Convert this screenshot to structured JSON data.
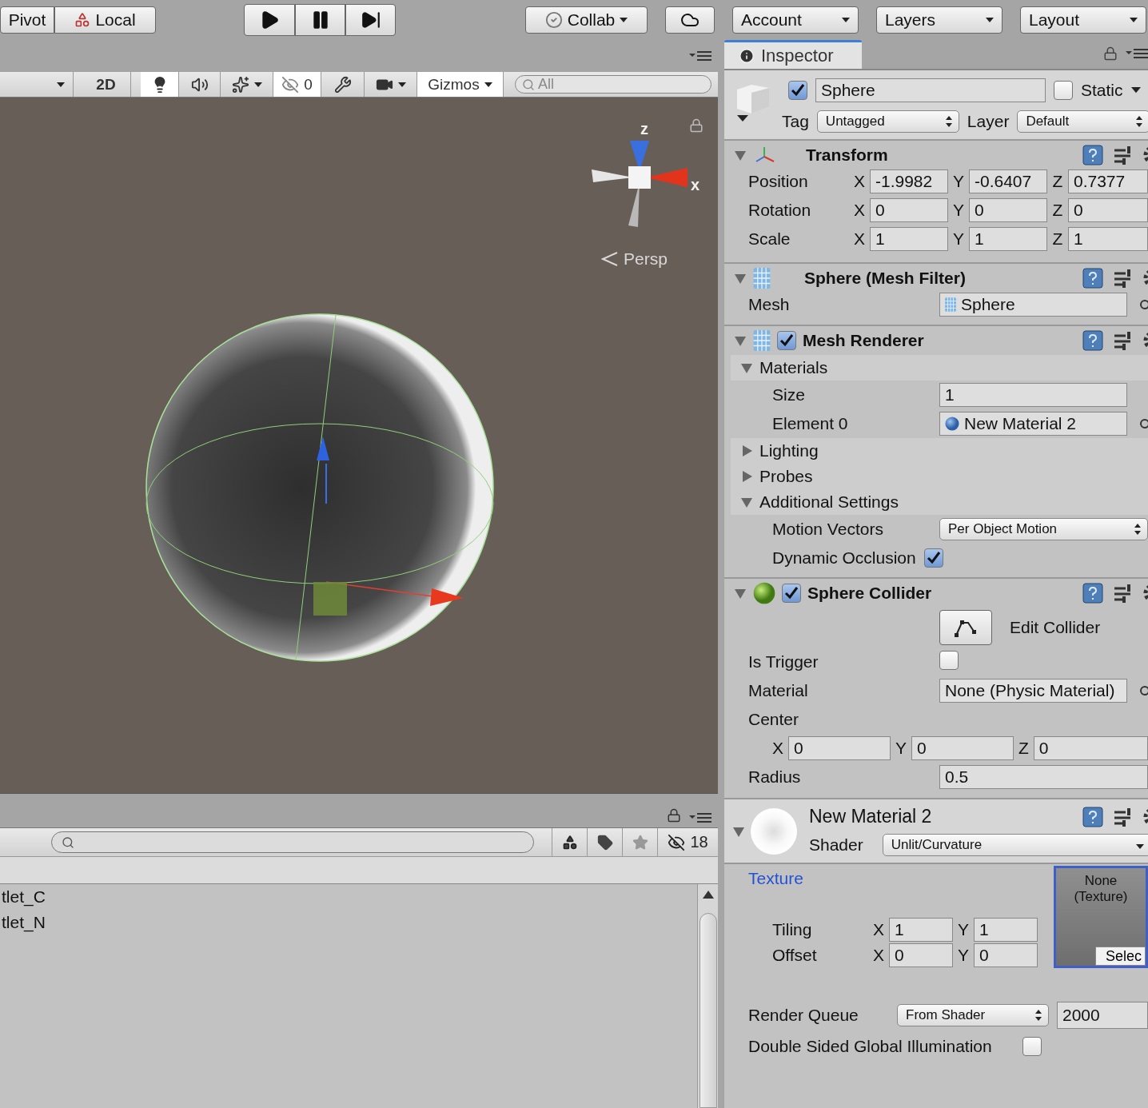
{
  "toolbar": {
    "pivot": "Pivot",
    "local": "Local",
    "collab": "Collab",
    "account": "Account",
    "layers": "Layers",
    "layout": "Layout"
  },
  "scene": {
    "two_d": {
      "label": "2D",
      "on": false
    },
    "lighting_on": true,
    "audio_on": false,
    "effects_on": false,
    "hidden_on": true,
    "hidden_count": "0",
    "gizmos": {
      "label": "Gizmos",
      "on": true
    },
    "search_placeholder": "All",
    "axis_z": "z",
    "axis_x": "x",
    "projection": "Persp"
  },
  "project": {
    "hidden_count": "18",
    "items": [
      "tlet_C",
      "tlet_N"
    ]
  },
  "inspector": {
    "tab": "Inspector",
    "object": {
      "active": true,
      "name": "Sphere",
      "static": false,
      "static_label": "Static",
      "tag_label": "Tag",
      "tag": "Untagged",
      "layer_label": "Layer",
      "layer": "Default"
    },
    "transform": {
      "title": "Transform",
      "expanded": true,
      "rows": [
        {
          "label": "Position",
          "values": [
            {
              "axis": "X",
              "value": "-1.9982"
            },
            {
              "axis": "Y",
              "value": "-0.6407"
            },
            {
              "axis": "Z",
              "value": "0.7377"
            }
          ]
        },
        {
          "label": "Rotation",
          "values": [
            {
              "axis": "X",
              "value": "0"
            },
            {
              "axis": "Y",
              "value": "0"
            },
            {
              "axis": "Z",
              "value": "0"
            }
          ]
        },
        {
          "label": "Scale",
          "values": [
            {
              "axis": "X",
              "value": "1"
            },
            {
              "axis": "Y",
              "value": "1"
            },
            {
              "axis": "Z",
              "value": "1"
            }
          ]
        }
      ]
    },
    "mesh_filter": {
      "title": "Sphere (Mesh Filter)",
      "expanded": true,
      "label": "Mesh",
      "value": "Sphere"
    },
    "mesh_renderer": {
      "title": "Mesh Renderer",
      "expanded": true,
      "enabled": true,
      "foldouts": [
        {
          "label": "Materials",
          "expanded": true,
          "rows": [
            {
              "kind": "number",
              "label": "Size",
              "value": "1"
            },
            {
              "kind": "object",
              "label": "Element 0",
              "value": "New Material 2"
            }
          ]
        },
        {
          "label": "Lighting",
          "expanded": false
        },
        {
          "label": "Probes",
          "expanded": false
        },
        {
          "label": "Additional Settings",
          "expanded": true,
          "rows": [
            {
              "kind": "dropdown",
              "label": "Motion Vectors",
              "value": "Per Object Motion"
            },
            {
              "kind": "checkbox",
              "label": "Dynamic Occlusion",
              "checked": true
            }
          ]
        }
      ]
    },
    "sphere_collider": {
      "title": "Sphere Collider",
      "expanded": true,
      "enabled": true,
      "edit_label": "Edit Collider",
      "trigger_label": "Is Trigger",
      "is_trigger": false,
      "material_label": "Material",
      "material": "None (Physic Material)",
      "center_label": "Center",
      "center": [
        {
          "axis": "X",
          "value": "0"
        },
        {
          "axis": "Y",
          "value": "0"
        },
        {
          "axis": "Z",
          "value": "0"
        }
      ],
      "radius_label": "Radius",
      "radius": "0.5"
    },
    "material": {
      "name": "New Material 2",
      "expanded": true,
      "shader_label": "Shader",
      "shader": "Unlit/Curvature",
      "texture_label": "Texture",
      "texture_slot": "None (Texture)",
      "select": "Selec",
      "tiling_label": "Tiling",
      "tiling": [
        {
          "axis": "X",
          "value": "1"
        },
        {
          "axis": "Y",
          "value": "1"
        }
      ],
      "offset_label": "Offset",
      "offset": [
        {
          "axis": "X",
          "value": "0"
        },
        {
          "axis": "Y",
          "value": "0"
        }
      ],
      "queue_label": "Render Queue",
      "queue_mode": "From Shader",
      "queue": "2000",
      "double_sided_label": "Double Sided Global Illumination",
      "double_sided": false
    }
  }
}
